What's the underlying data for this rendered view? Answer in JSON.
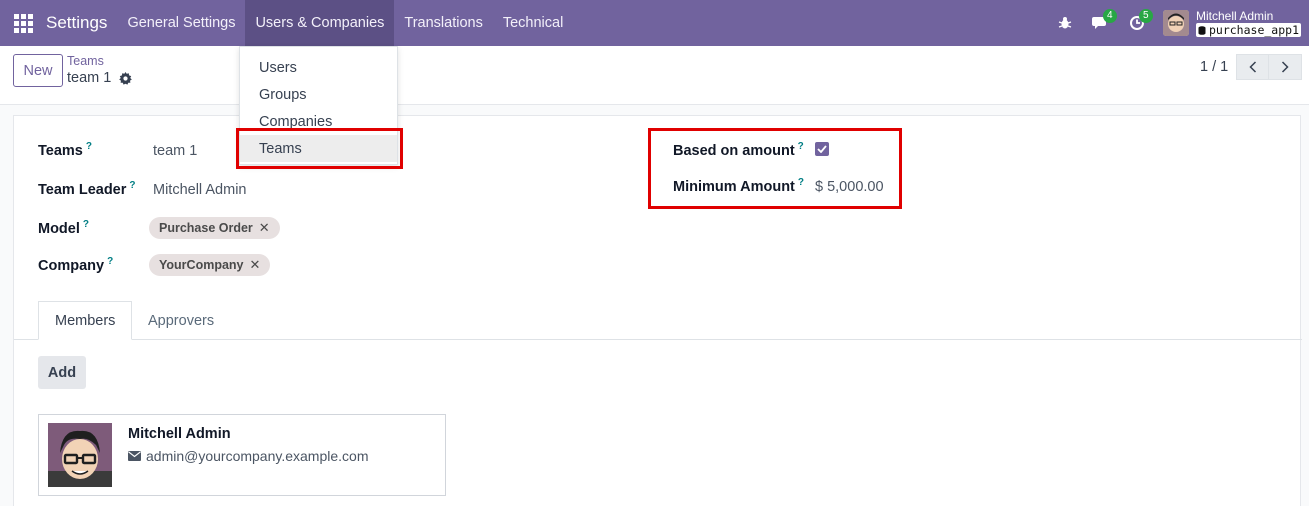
{
  "navbar": {
    "brand": "Settings",
    "menu": [
      {
        "label": "General Settings"
      },
      {
        "label": "Users & Companies"
      },
      {
        "label": "Translations"
      },
      {
        "label": "Technical"
      }
    ],
    "chat_badge": "4",
    "activity_badge": "5",
    "user_name": "Mitchell Admin",
    "db_name": "purchase_app1"
  },
  "control": {
    "new_label": "New",
    "breadcrumb_parent": "Teams",
    "breadcrumb_current": "team 1",
    "pager": "1 / 1"
  },
  "dropdown": {
    "items": [
      {
        "label": "Users"
      },
      {
        "label": "Groups"
      },
      {
        "label": "Companies"
      },
      {
        "label": "Teams"
      }
    ]
  },
  "form": {
    "teams_label": "Teams",
    "teams_value": "team 1",
    "leader_label": "Team Leader",
    "leader_value": "Mitchell Admin",
    "model_label": "Model",
    "model_tag": "Purchase Order",
    "company_label": "Company",
    "company_tag": "YourCompany",
    "based_on_amount_label": "Based on amount",
    "based_on_amount_checked": true,
    "min_amount_label": "Minimum Amount",
    "min_amount_value": "$ 5,000.00",
    "help_mark": "?"
  },
  "tabs": [
    {
      "label": "Members"
    },
    {
      "label": "Approvers"
    }
  ],
  "members": {
    "add_label": "Add",
    "items": [
      {
        "name": "Mitchell Admin",
        "email": "admin@yourcompany.example.com"
      }
    ]
  },
  "colors": {
    "brand": "#71639e",
    "annotation": "#e00000",
    "badge": "#28a745"
  }
}
